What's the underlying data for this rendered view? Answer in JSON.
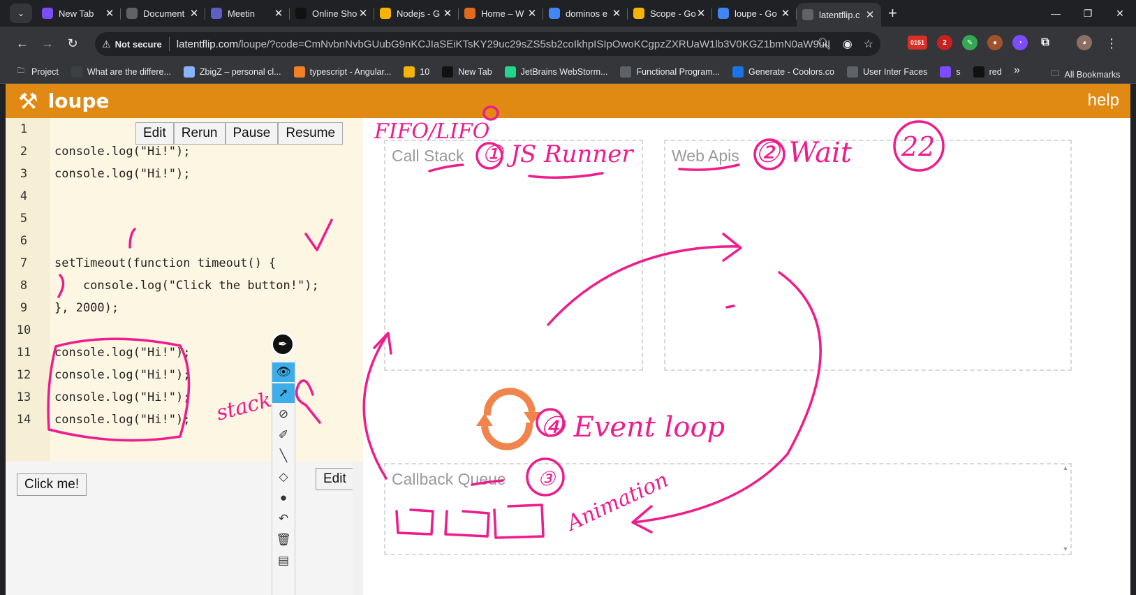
{
  "browser": {
    "tabs": [
      {
        "title": "New Tab",
        "icon": "new-tab-icon",
        "color": "#7c4dff"
      },
      {
        "title": "Document",
        "icon": "globe-icon",
        "color": "#5f6368"
      },
      {
        "title": "Meetin",
        "icon": "teams-icon",
        "color": "#5b5fc7"
      },
      {
        "title": "Online Sho",
        "icon": "amazon-icon",
        "color": "#111111"
      },
      {
        "title": "Nodejs - G",
        "icon": "slides-icon",
        "color": "#f4b400"
      },
      {
        "title": "Home – W",
        "icon": "wordpress-icon",
        "color": "#e26a1a"
      },
      {
        "title": "dominos e",
        "icon": "google-icon",
        "color": "#4285f4"
      },
      {
        "title": "Scope - Go",
        "icon": "slides-icon",
        "color": "#f4b400"
      },
      {
        "title": "loupe - Go",
        "icon": "google-icon",
        "color": "#4285f4"
      },
      {
        "title": "latentflip.c",
        "icon": "globe-icon",
        "color": "#5f6368"
      }
    ],
    "not_secure": "Not secure",
    "url_host": "latentflip.com",
    "url_path": "/loupe/?code=CmNvbnNvbGUubG9nKCJIaSEiKTsKY29uc29sZS5sb2coIkhpISIpOwoKCgpzZXRUaW1lb3V0KGZ1bmN0aW9uIHRpb...",
    "ext_badge": "0151",
    "ext_badge2": "2",
    "bookmarks": [
      {
        "label": "Project",
        "icon": "folder-icon"
      },
      {
        "label": "What are the differe...",
        "icon": "bookmark-icon"
      },
      {
        "label": "ZbigZ – personal cl...",
        "icon": "cloud-icon"
      },
      {
        "label": "typescript - Angular...",
        "icon": "stackoverflow-icon"
      },
      {
        "label": "10",
        "icon": "bookmark-icon"
      },
      {
        "label": "New Tab",
        "icon": "new-tab-icon"
      },
      {
        "label": "JetBrains WebStorm...",
        "icon": "jetbrains-icon"
      },
      {
        "label": "Functional Program...",
        "icon": "bookmark-icon"
      },
      {
        "label": "Generate - Coolors.co",
        "icon": "coolors-icon"
      },
      {
        "label": "User Inter Faces",
        "icon": "bookmark-icon"
      },
      {
        "label": "s",
        "icon": "bookmark-icon"
      },
      {
        "label": "red",
        "icon": "bookmark-icon"
      }
    ],
    "all_bookmarks": "All Bookmarks"
  },
  "app": {
    "title": "loupe",
    "help": "help",
    "accent": "#e08a13"
  },
  "editor": {
    "buttons": [
      "Edit",
      "Rerun",
      "Pause",
      "Resume"
    ],
    "lines": [
      {
        "n": "1",
        "code": ""
      },
      {
        "n": "2",
        "code": "console.log(\"Hi!\");"
      },
      {
        "n": "3",
        "code": "console.log(\"Hi!\");"
      },
      {
        "n": "4",
        "code": ""
      },
      {
        "n": "5",
        "code": ""
      },
      {
        "n": "6",
        "code": ""
      },
      {
        "n": "7",
        "code": "setTimeout(function timeout() {"
      },
      {
        "n": "8",
        "code": "    console.log(\"Click the button!\");"
      },
      {
        "n": "9",
        "code": "}, 2000);"
      },
      {
        "n": "10",
        "code": ""
      },
      {
        "n": "11",
        "code": "console.log(\"Hi!\");"
      },
      {
        "n": "12",
        "code": "console.log(\"Hi!\");"
      },
      {
        "n": "13",
        "code": "console.log(\"Hi!\");"
      },
      {
        "n": "14",
        "code": "console.log(\"Hi!\");"
      }
    ]
  },
  "html_pane": {
    "click_button": "Click me!",
    "edit_button": "Edit"
  },
  "viz": {
    "call_stack": "Call Stack",
    "web_apis": "Web Apis",
    "callback_queue": "Callback Queue"
  },
  "annotations": {
    "fifo": "FIFO/LIFO",
    "js_runner": "① JS Runner",
    "wait": "② Wait",
    "twenty_two": "22",
    "event_loop": "④ Event loop",
    "queue_num": "③",
    "animation": "Animation",
    "stack": "stack",
    "ink_color": "#ee1c8c"
  }
}
